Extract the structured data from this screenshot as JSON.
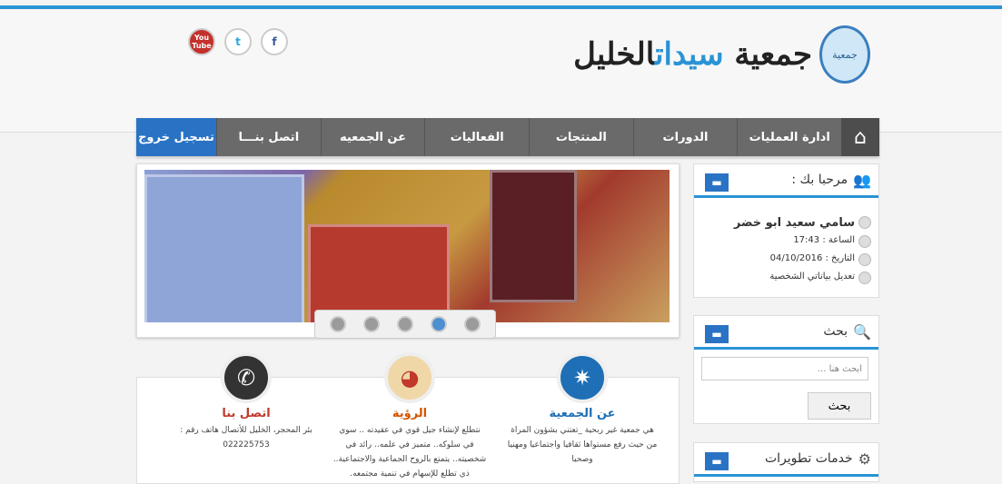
{
  "brand": {
    "logo_text": "جمعية",
    "title_main": "جمعية ",
    "title_highlight": "سيدات",
    "title_end": "الخليل"
  },
  "social": {
    "youtube": "You Tube",
    "twitter": "t",
    "facebook": "f"
  },
  "nav": {
    "items": [
      "ادارة العمليات",
      "الدورات",
      "المنتجات",
      "الفعاليات",
      "عن الجمعيه",
      "اتصل بنـــا"
    ],
    "logout": "تسجيل خروج"
  },
  "slider": {
    "dots": 5,
    "active_dot": 4
  },
  "info": {
    "about": {
      "title": "عن الجمعية",
      "text": "هي جمعية غير ربحية _تعتني بشؤون المراة من حيث رفع مستواها ثقافيا واجتماعيا ومهنيا وصحيا"
    },
    "vision": {
      "title": "الرؤية",
      "text": "نتطلع لإنشاء جيل قوي في عقيدته .. سوي في سلوكه.. متميز في علمه.. رائد في شخصيته.. يتمتع بالروح الجماعية والاجتماعية.. ذي تطلع للإسهام في تنمية مجتمعه."
    },
    "contact": {
      "title": "اتصل بنا",
      "text": "بئر المحجر، الخليل للأتصال هاتف رقم : 022225753"
    }
  },
  "welcome": {
    "title": "مرحبا بك :",
    "name": "سامي سعيد ابو خضر",
    "time": "الساعة : 17:43",
    "date": "التاريخ : 04/10/2016",
    "edit": "تعديل بياناتي الشخصية"
  },
  "search": {
    "title": "بحث",
    "placeholder": "ابحث هنا ...",
    "button": "بحث"
  },
  "services": {
    "title": "خدمات تطويرات"
  }
}
